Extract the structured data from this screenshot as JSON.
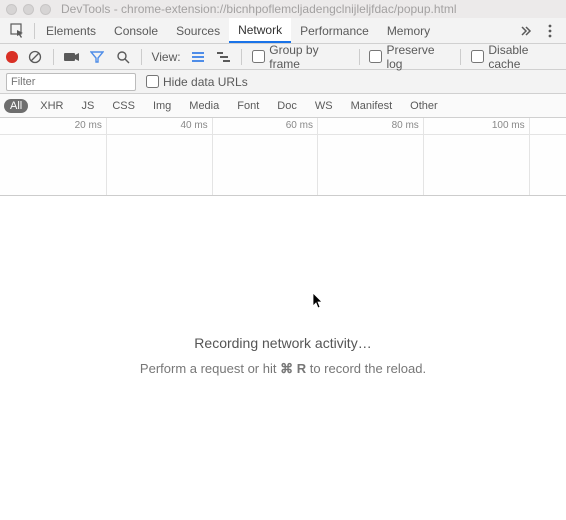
{
  "window": {
    "title": "DevTools - chrome-extension://bicnhpoflemcljadengclnijleljfdac/popup.html"
  },
  "tabs": {
    "items": [
      "Elements",
      "Console",
      "Sources",
      "Network",
      "Performance",
      "Memory"
    ],
    "active_index": 3
  },
  "toolbar": {
    "view_label": "View:",
    "group_by_frame": "Group by frame",
    "preserve_log": "Preserve log",
    "disable_cache": "Disable cache"
  },
  "filter": {
    "placeholder": "Filter",
    "hide_data_urls": "Hide data URLs"
  },
  "type_filters": {
    "items": [
      "All",
      "XHR",
      "JS",
      "CSS",
      "Img",
      "Media",
      "Font",
      "Doc",
      "WS",
      "Manifest",
      "Other"
    ],
    "active_index": 0
  },
  "timeline": {
    "ticks": [
      "20 ms",
      "40 ms",
      "60 ms",
      "80 ms",
      "100 ms"
    ]
  },
  "empty_state": {
    "title": "Recording network activity…",
    "hint_before": "Perform a request or hit ",
    "hint_shortcut": "⌘ R",
    "hint_after": " to record the reload."
  }
}
